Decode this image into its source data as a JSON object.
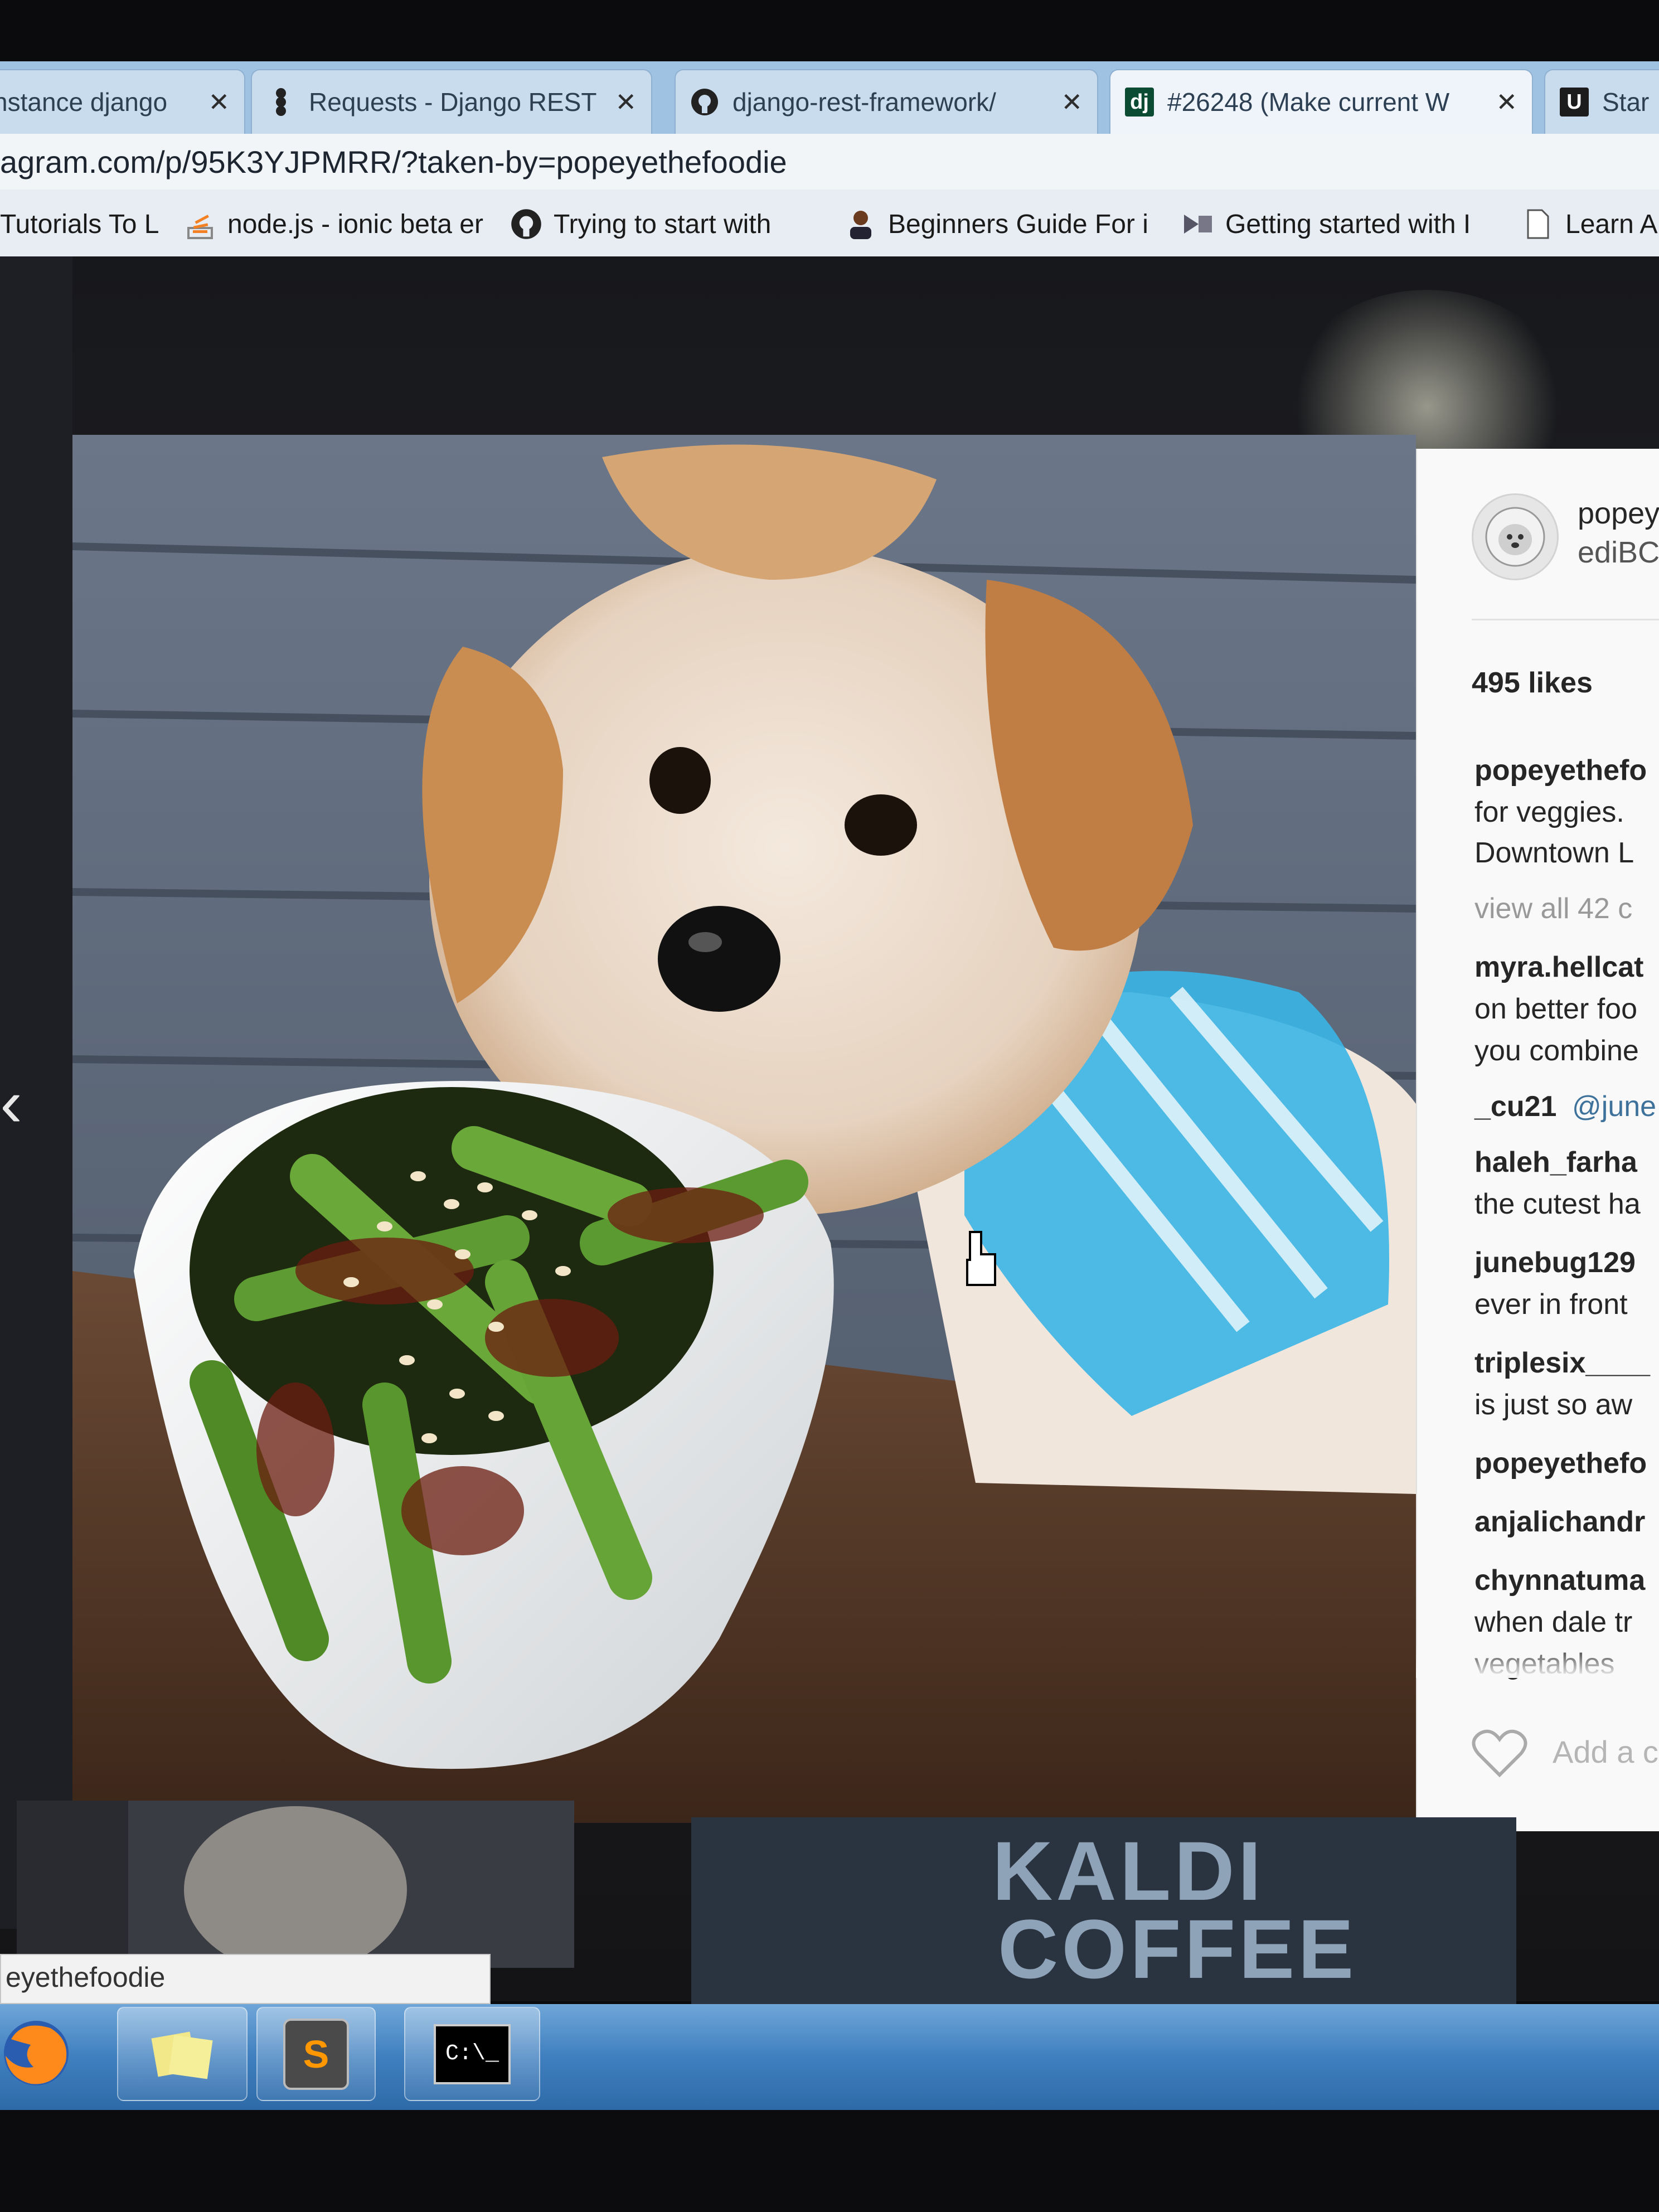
{
  "tabs": [
    {
      "title": "nstance django",
      "icon": "document-icon"
    },
    {
      "title": "Requests - Django REST",
      "icon": "django-rest-icon"
    },
    {
      "title": "django-rest-framework/",
      "icon": "github-icon"
    },
    {
      "title": "#26248 (Make current W",
      "icon": "django-icon",
      "icon_text": "dj"
    },
    {
      "title": "Star",
      "icon": "udemy-icon",
      "icon_text": "U"
    }
  ],
  "address_bar": {
    "url": "agram.com/p/95K3YJPMRR/?taken-by=popeyethefoodie"
  },
  "bookmarks": [
    {
      "label": "Tutorials To L",
      "icon": "bookmark-icon"
    },
    {
      "label": "node.js - ionic beta er",
      "icon": "stackoverflow-icon"
    },
    {
      "label": "Trying to start with",
      "icon": "github-icon"
    },
    {
      "label": "Beginners Guide For i",
      "icon": "user-icon"
    },
    {
      "label": "Getting started with I",
      "icon": "ionic-icon"
    },
    {
      "label": "Learn A",
      "icon": "page-icon"
    }
  ],
  "post": {
    "username": "popeye",
    "subtitle": "ediBC",
    "likes": "495 likes",
    "caption": {
      "user": "popeyethefo",
      "lines": [
        "for veggies.",
        "Downtown L"
      ]
    },
    "view_all": "view all 42 c",
    "comments": [
      {
        "user": "myra.hellcat",
        "lines": [
          "on better foo",
          "you combine"
        ]
      },
      {
        "user": "_cu21",
        "mention": "@june",
        "lines": []
      },
      {
        "user": "haleh_farha",
        "lines": [
          "the cutest ha"
        ]
      },
      {
        "user": "junebug129",
        "lines": [
          "ever in front"
        ]
      },
      {
        "user": "triplesix____",
        "lines": [
          "is just so aw"
        ]
      },
      {
        "user": "popeyethefo",
        "lines": []
      },
      {
        "user": "anjalichandr",
        "lines": []
      },
      {
        "user": "chynnatuma",
        "lines": [
          "when dale tr",
          "vegetables"
        ]
      }
    ],
    "add_comment_placeholder": "Add a c"
  },
  "thumbnails": {
    "sign_line1": "KALDI",
    "sign_line2": "COFFEE"
  },
  "status_bar": {
    "text": "eyethefoodie"
  },
  "taskbar": {
    "apps": [
      {
        "name": "firefox-icon"
      },
      {
        "name": "sticky-notes-icon"
      },
      {
        "name": "sublime-text-icon",
        "icon_text": "S"
      },
      {
        "name": "command-prompt-icon",
        "icon_text": "C:\\_"
      }
    ]
  },
  "colors": {
    "instagram_link": "#3f729b",
    "taskbar": "#3f7fbf",
    "tab_bar": "#9fc2e2"
  }
}
